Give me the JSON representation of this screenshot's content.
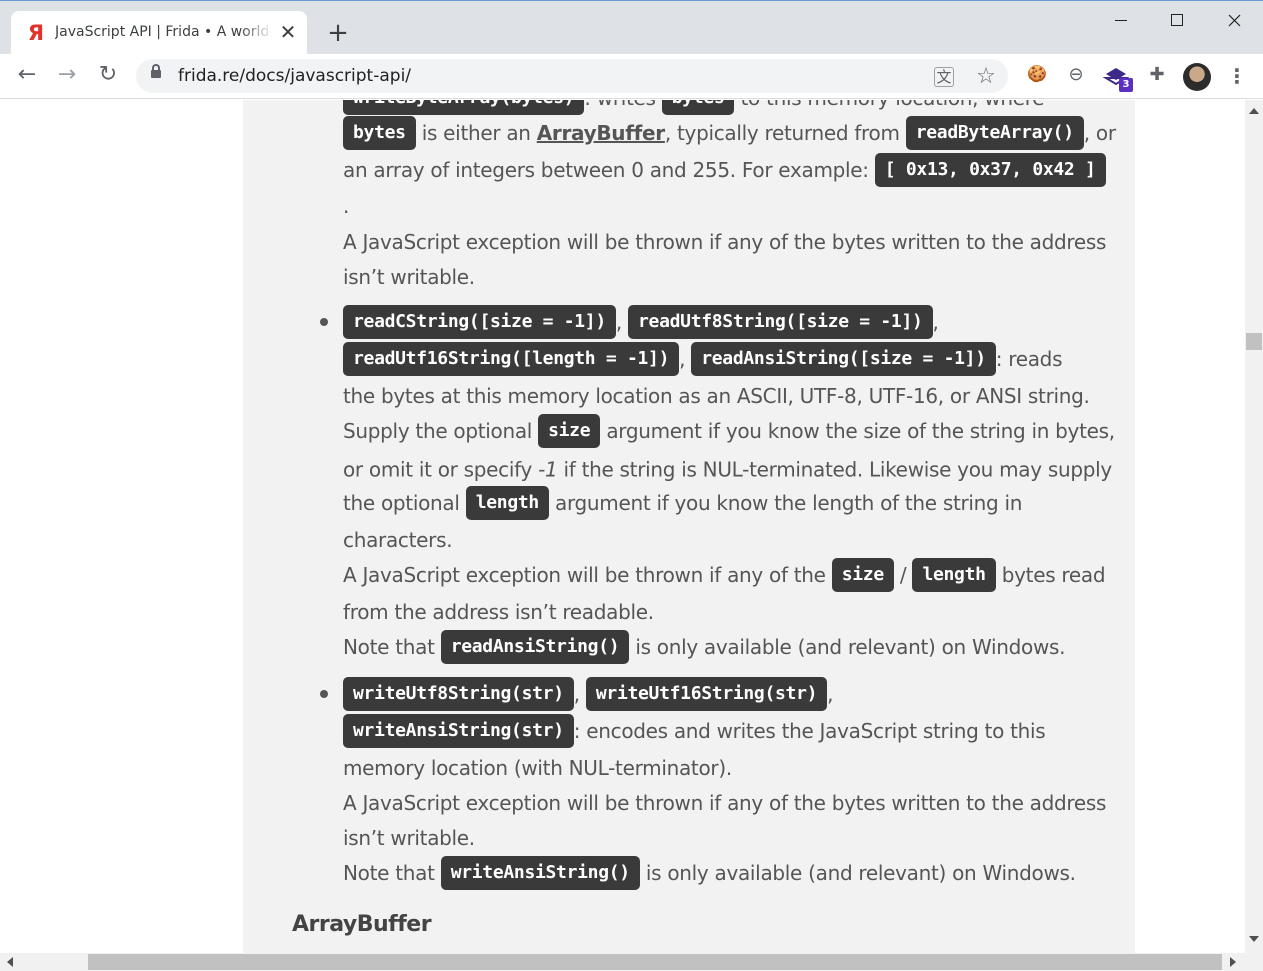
{
  "browser": {
    "tab_title": "JavaScript API | Frida • A world-class dynamic instrumentation toolkit",
    "tab_favicon": "Я",
    "url": "frida.re/docs/javascript-api/",
    "extension_badge": "3",
    "accent_color": "#5b2fbf"
  },
  "icons": {
    "close": "✕",
    "new_tab": "+",
    "back": "←",
    "forward": "→",
    "reload": "↻",
    "translate": "文",
    "star": "☆",
    "cookie": "🍪",
    "blocker": "⊖",
    "extensions": "✚",
    "menu": "⋮"
  },
  "content": {
    "top_partial": {
      "code1": "writeByteArray(bytes)",
      "t1": ": writes ",
      "code2": "bytes",
      "t2": " to this memory location, where"
    },
    "write_byte_array": {
      "code_bytes": "bytes",
      "t1": " is either an ",
      "link": "ArrayBuffer",
      "t2": ", typically returned from ",
      "code_read": "readByteArray()",
      "t3": ", or",
      "t4": "an array of integers between 0 and 255. For example: ",
      "code_example": "[ 0x13, 0x37, 0x42 ]",
      "t5": ".",
      "exception_1": "A JavaScript exception will be thrown if any of the bytes written to the address",
      "exception_2": "isn’t writable."
    },
    "read_strings": {
      "code1": "readCString([size = -1])",
      "sep1": ",",
      "code2": "readUtf8String([size = -1])",
      "sep2": ",",
      "code3": "readUtf16String([length = -1])",
      "sep3": ",",
      "code4": "readAnsiString([size = -1])",
      "t1": ": reads",
      "t2": "the bytes at this memory location as an ASCII, UTF-8, UTF-16, or ANSI string.",
      "t3": "Supply the optional ",
      "code_size": "size",
      "t4": " argument if you know the size of the string in bytes,",
      "t5a": "or omit it or specify ",
      "t5b": "-1",
      "t5c": " if the string is NUL-terminated. Likewise you may supply",
      "t6a": "the optional ",
      "code_length": "length",
      "t6b": " argument if you know the length of the string in",
      "t7": "characters.",
      "t8a": "A JavaScript exception will be thrown if any of the ",
      "code_size2": "size",
      "t8b": " / ",
      "code_length2": "length",
      "t8c": " bytes read",
      "t9": "from the address isn’t readable.",
      "t10a": "Note that ",
      "code_ansi": "readAnsiString()",
      "t10b": " is only available (and relevant) on Windows."
    },
    "write_strings": {
      "code1": "writeUtf8String(str)",
      "sep1": ",",
      "code2": "writeUtf16String(str)",
      "sep2": ",",
      "code3": "writeAnsiString(str)",
      "t1": ": encodes and writes the JavaScript string to this",
      "t2": "memory location (with NUL-terminator).",
      "t3": "A JavaScript exception will be thrown if any of the bytes written to the address",
      "t4": "isn’t writable.",
      "t5a": "Note that ",
      "code_ansi": "writeAnsiString()",
      "t5b": " is only available (and relevant) on Windows."
    },
    "next_heading": "ArrayBuffer"
  }
}
